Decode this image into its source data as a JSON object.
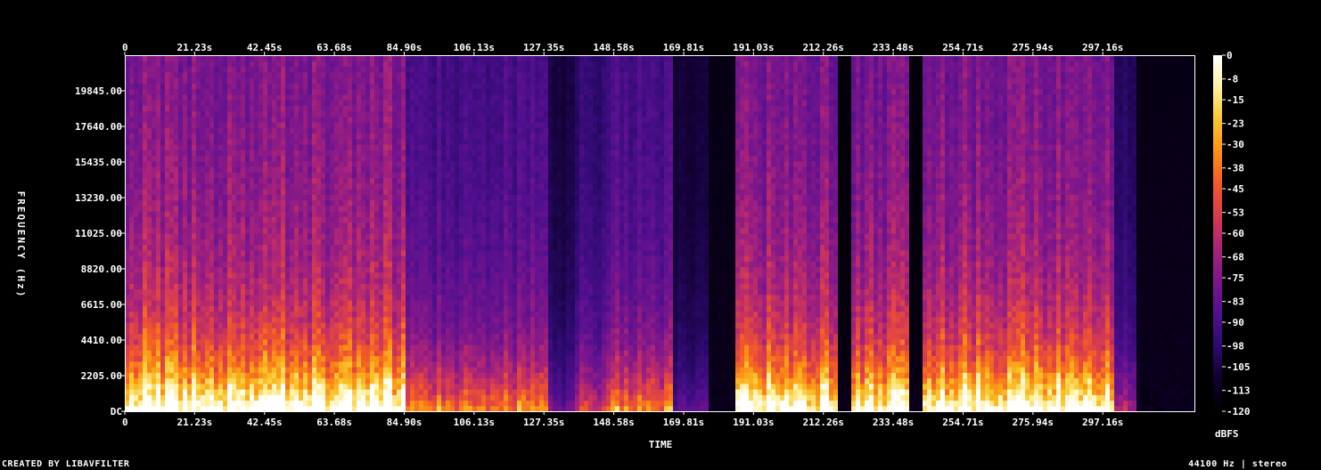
{
  "footer": {
    "credit": "CREATED BY LIBAVFILTER",
    "sample_info": "44100 Hz | stereo"
  },
  "chart_data": {
    "type": "heatmap",
    "title": "",
    "xlabel": "TIME",
    "ylabel": "FREQUENCY (Hz)",
    "colorbar_label": "dBFS",
    "x_unit": "s",
    "xlim": [
      0,
      325
    ],
    "ylim": [
      0,
      22050
    ],
    "x_ticks_top": [
      "0",
      "21.23s",
      "42.45s",
      "63.68s",
      "84.90s",
      "106.13s",
      "127.35s",
      "148.58s",
      "169.81s",
      "191.03s",
      "212.26s",
      "233.48s",
      "254.71s",
      "275.94s",
      "297.16s"
    ],
    "x_ticks_bottom": [
      "0",
      "21.23s",
      "42.45s",
      "63.68s",
      "84.90s",
      "106.13s",
      "127.35s",
      "148.58s",
      "169.81s",
      "191.03s",
      "212.26s",
      "233.48s",
      "254.71s",
      "275.94s",
      "297.16s"
    ],
    "x_tick_values": [
      0,
      21.23,
      42.45,
      63.68,
      84.9,
      106.13,
      127.35,
      148.58,
      169.81,
      191.03,
      212.26,
      233.48,
      254.71,
      275.94,
      297.16
    ],
    "y_ticks": [
      "DC",
      "2205.00",
      "4410.00",
      "6615.00",
      "8820.00",
      "11025.00",
      "13230.00",
      "15435.00",
      "17640.00",
      "19845.00"
    ],
    "y_tick_values": [
      0,
      2205,
      4410,
      6615,
      8820,
      11025,
      13230,
      15435,
      17640,
      19845
    ],
    "colorbar_ticks": [
      "0",
      "-8",
      "-15",
      "-23",
      "-30",
      "-38",
      "-45",
      "-53",
      "-60",
      "-68",
      "-75",
      "-83",
      "-90",
      "-98",
      "-105",
      "-113",
      "-120"
    ],
    "colorbar_range": [
      -120,
      0
    ],
    "colormap": [
      "#000000",
      "#10002e",
      "#2c0a6e",
      "#520f8f",
      "#7a168c",
      "#a8237a",
      "#d43a52",
      "#f2582a",
      "#fb8f15",
      "#f8c52a",
      "#fff0a0",
      "#ffffff"
    ],
    "segments": [
      {
        "start": 0,
        "end": 84.9,
        "level": 0.95
      },
      {
        "start": 84.9,
        "end": 110,
        "level": 0.6
      },
      {
        "start": 110,
        "end": 128,
        "level": 0.62
      },
      {
        "start": 128,
        "end": 137,
        "level": 0.3
      },
      {
        "start": 137,
        "end": 146,
        "level": 0.48
      },
      {
        "start": 146,
        "end": 166,
        "level": 0.62
      },
      {
        "start": 166,
        "end": 178,
        "level": 0.25
      },
      {
        "start": 178,
        "end": 186,
        "level": 0.02
      },
      {
        "start": 186,
        "end": 216,
        "level": 0.9
      },
      {
        "start": 216,
        "end": 221,
        "level": 0.05
      },
      {
        "start": 221,
        "end": 239,
        "level": 0.9
      },
      {
        "start": 239,
        "end": 242,
        "level": 0.05
      },
      {
        "start": 242,
        "end": 300,
        "level": 0.92
      },
      {
        "start": 300,
        "end": 307,
        "level": 0.4
      },
      {
        "start": 307,
        "end": 325,
        "level": 0.0
      }
    ]
  }
}
